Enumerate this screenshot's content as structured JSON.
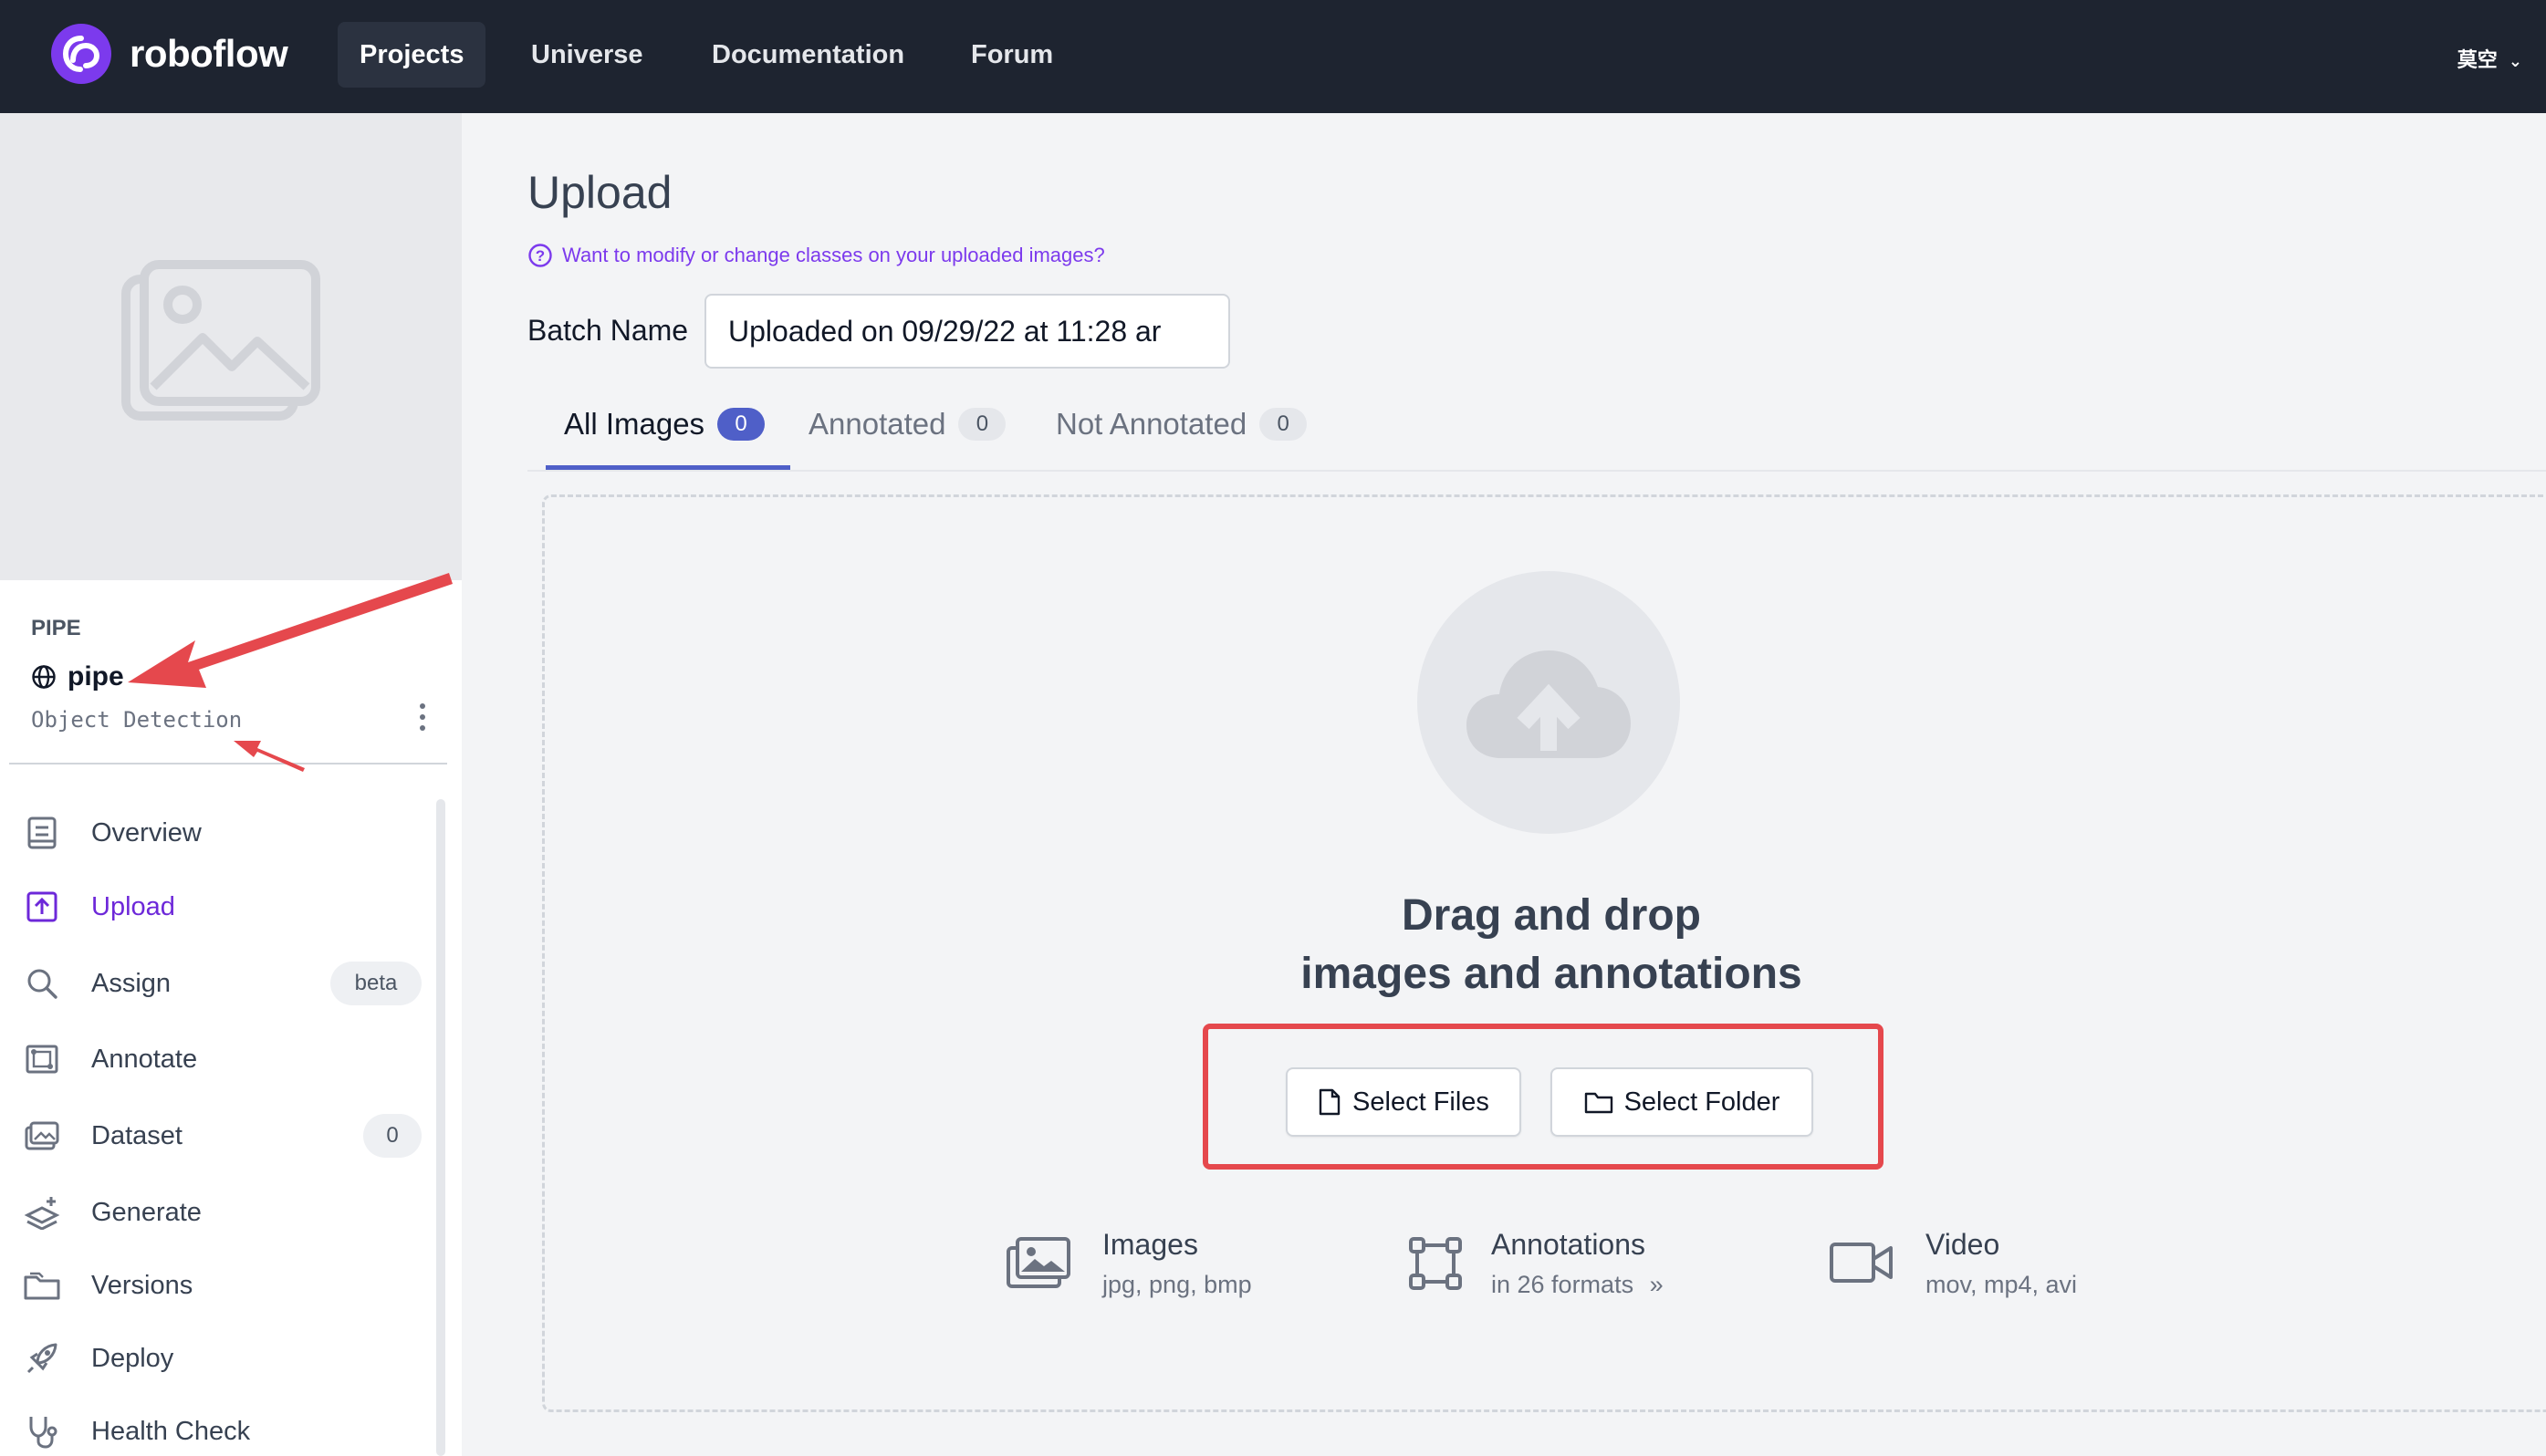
{
  "topnav": {
    "brand": "roboflow",
    "items": [
      {
        "label": "Projects",
        "active": true
      },
      {
        "label": "Universe",
        "active": false
      },
      {
        "label": "Documentation",
        "active": false
      },
      {
        "label": "Forum",
        "active": false
      }
    ],
    "user": "莫空"
  },
  "sidebar": {
    "project_group": "PIPE",
    "project_name": "pipe",
    "project_type": "Object Detection",
    "items": [
      {
        "label": "Overview",
        "icon": "overview-icon"
      },
      {
        "label": "Upload",
        "icon": "upload-icon",
        "active": true
      },
      {
        "label": "Assign",
        "icon": "search-icon",
        "badge": "beta"
      },
      {
        "label": "Annotate",
        "icon": "annotate-icon"
      },
      {
        "label": "Dataset",
        "icon": "dataset-icon",
        "badge": "0"
      },
      {
        "label": "Generate",
        "icon": "generate-icon"
      },
      {
        "label": "Versions",
        "icon": "versions-icon"
      },
      {
        "label": "Deploy",
        "icon": "rocket-icon"
      },
      {
        "label": "Health Check",
        "icon": "stethoscope-icon"
      }
    ]
  },
  "main": {
    "title": "Upload",
    "help_link": "Want to modify or change classes on your uploaded images?",
    "batch_label": "Batch Name",
    "batch_value": "Uploaded on 09/29/22 at 11:28 ar",
    "tabs": [
      {
        "label": "All Images",
        "count": "0",
        "active": true
      },
      {
        "label": "Annotated",
        "count": "0"
      },
      {
        "label": "Not Annotated",
        "count": "0"
      }
    ],
    "dropzone": {
      "line1": "Drag and drop",
      "line2": "images and annotations",
      "select_files": "Select Files",
      "select_folder": "Select Folder"
    },
    "formats": [
      {
        "title": "Images",
        "sub": "jpg, png, bmp",
        "icon": "images-icon"
      },
      {
        "title": "Annotations",
        "sub": "in 26 formats",
        "icon": "bounding-box-icon"
      },
      {
        "title": "Video",
        "sub": "mov, mp4, avi",
        "icon": "video-icon"
      }
    ]
  },
  "colors": {
    "accent": "#7c3aed",
    "tab_accent": "#4f5fc8",
    "nav_bg": "#1e2430",
    "annotation_red": "#e5484d"
  }
}
